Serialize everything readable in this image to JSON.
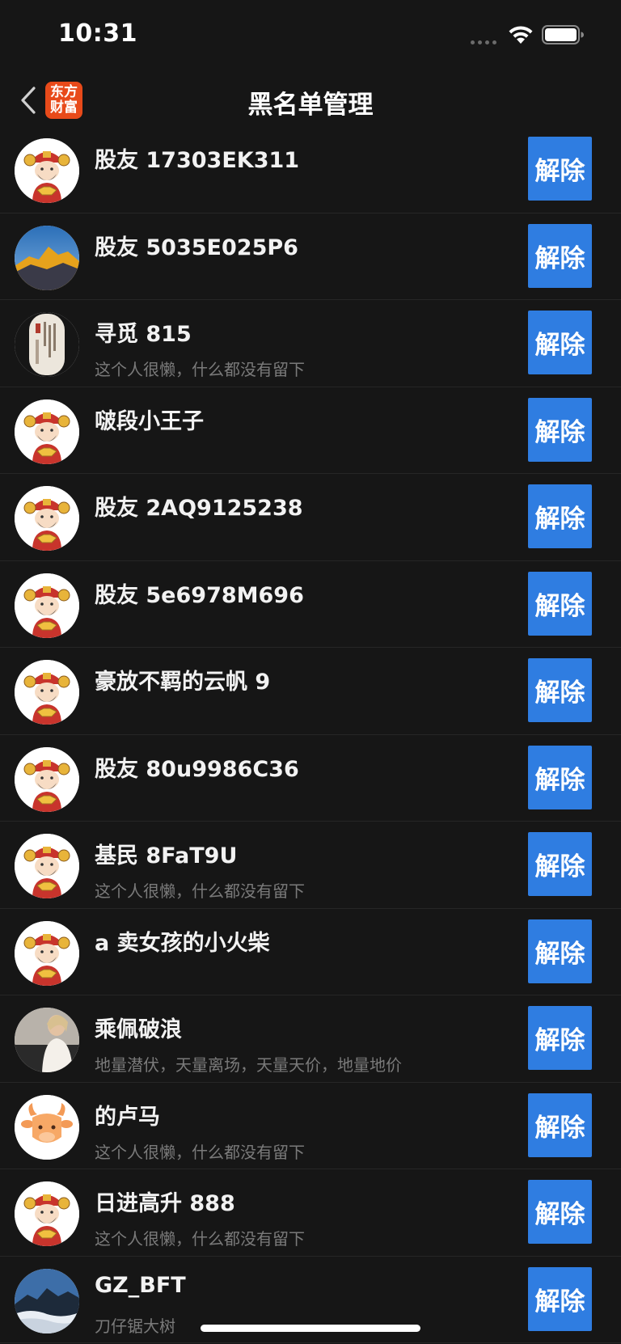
{
  "status_bar": {
    "time": "10:31"
  },
  "nav": {
    "title": "黑名单管理",
    "logo_line1": "东方",
    "logo_line2": "财富"
  },
  "colors": {
    "background": "#161616",
    "button": "#2f7de1",
    "logo": "#e84a1a"
  },
  "items": [
    {
      "name": "股友 17303EK311",
      "bio": "",
      "avatar": "god-of-wealth-avatar",
      "button": "解除"
    },
    {
      "name": "股友 5035E025P6",
      "bio": "",
      "avatar": "mountain-sunset-avatar",
      "button": "解除"
    },
    {
      "name": "寻觅 815",
      "bio": "这个人很懒，什么都没有留下",
      "avatar": "scroll-painting-avatar",
      "button": "解除"
    },
    {
      "name": "啵段小王子",
      "bio": "",
      "avatar": "god-of-wealth-avatar",
      "button": "解除"
    },
    {
      "name": "股友 2AQ9125238",
      "bio": "",
      "avatar": "god-of-wealth-avatar",
      "button": "解除"
    },
    {
      "name": "股友 5e6978M696",
      "bio": "",
      "avatar": "god-of-wealth-avatar",
      "button": "解除"
    },
    {
      "name": "豪放不羁的云帆 9",
      "bio": "",
      "avatar": "god-of-wealth-avatar",
      "button": "解除"
    },
    {
      "name": "股友 80u9986C36",
      "bio": "",
      "avatar": "god-of-wealth-avatar",
      "button": "解除"
    },
    {
      "name": "基民 8FaT9U",
      "bio": "这个人很懒，什么都没有留下",
      "avatar": "god-of-wealth-avatar",
      "button": "解除"
    },
    {
      "name": "a 卖女孩的小火柴",
      "bio": "",
      "avatar": "god-of-wealth-avatar",
      "button": "解除"
    },
    {
      "name": "乘佩破浪",
      "bio": "地量潜伏，天量离场，天量天价，地量地价",
      "avatar": "person-photo-avatar",
      "button": "解除"
    },
    {
      "name": "的卢马",
      "bio": "这个人很懒，什么都没有留下",
      "avatar": "cartoon-ox-avatar",
      "button": "解除"
    },
    {
      "name": "日进高升 888",
      "bio": "这个人很懒，什么都没有留下",
      "avatar": "god-of-wealth-avatar",
      "button": "解除"
    },
    {
      "name": "GZ_BFT",
      "bio": "刀仔锯大树",
      "avatar": "mountain-clouds-avatar",
      "button": "解除"
    }
  ]
}
